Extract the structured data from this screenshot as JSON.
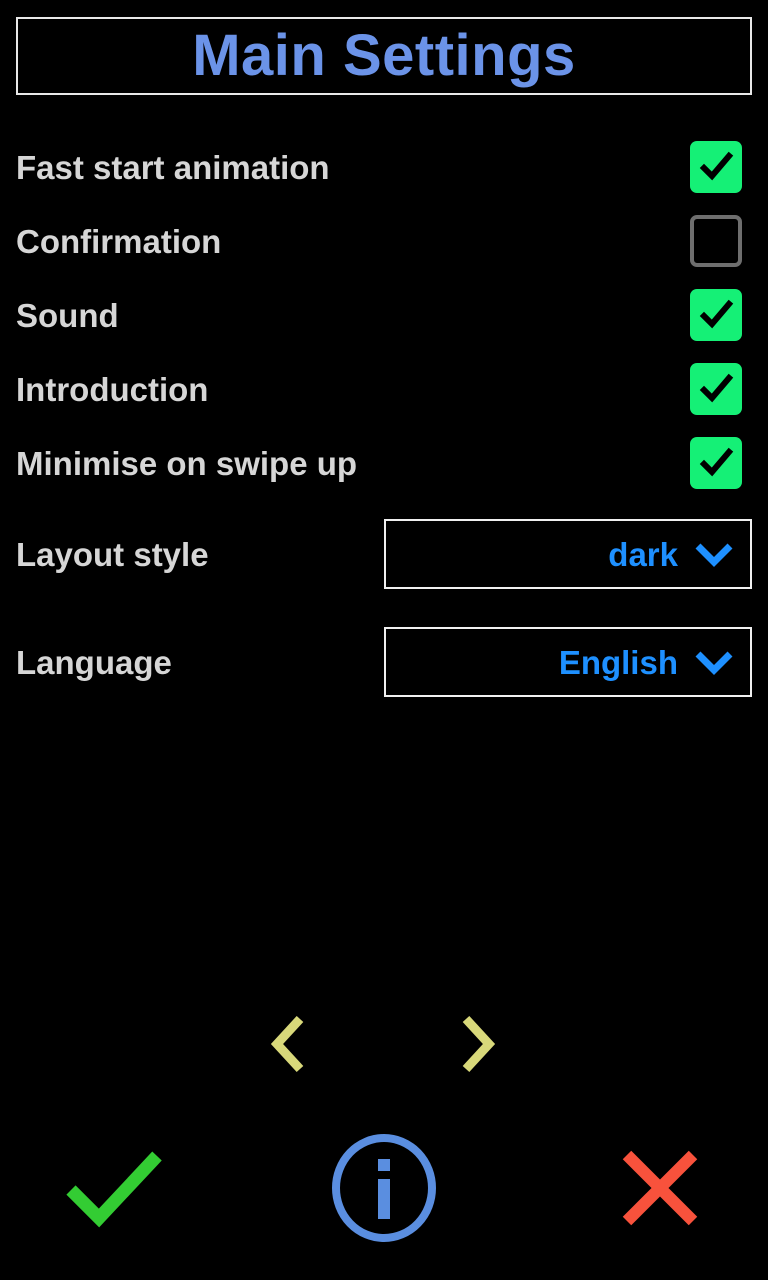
{
  "header": {
    "title": "Main Settings",
    "title_color": "#6b93e8",
    "border_color": "#e8e8e8"
  },
  "settings": {
    "toggles": [
      {
        "label": "Fast start animation",
        "checked": true,
        "checkbox_name": "checkbox-fast-start-animation"
      },
      {
        "label": "Confirmation",
        "checked": false,
        "checkbox_name": "checkbox-confirmation"
      },
      {
        "label": "Sound",
        "checked": true,
        "checkbox_name": "checkbox-sound"
      },
      {
        "label": "Introduction",
        "checked": true,
        "checkbox_name": "checkbox-introduction"
      },
      {
        "label": "Minimise on swipe up",
        "checked": true,
        "checkbox_name": "checkbox-minimise-on-swipe-up"
      }
    ],
    "selects": [
      {
        "label": "Layout style",
        "value": "dark",
        "caret": "chevron-down-icon"
      },
      {
        "label": "Language",
        "value": "English",
        "caret": "chevron-down-icon"
      }
    ],
    "label_color": "#d6d6d6",
    "checked_color": "#15f076",
    "unchecked_border_color": "#6e6e6e",
    "select_value_color": "#1e90ff",
    "select_border_color": "#f0f0f0"
  },
  "pager": {
    "prev_icon": "chevron-left-icon",
    "next_icon": "chevron-right-icon",
    "color": "#d8d87a"
  },
  "actions": {
    "confirm": {
      "icon": "check-icon",
      "color": "#33cc33"
    },
    "info": {
      "icon": "info-circle-icon",
      "glyph": "i",
      "color": "#5a8ee0"
    },
    "cancel": {
      "icon": "close-x-icon",
      "color": "#f8523c"
    }
  }
}
